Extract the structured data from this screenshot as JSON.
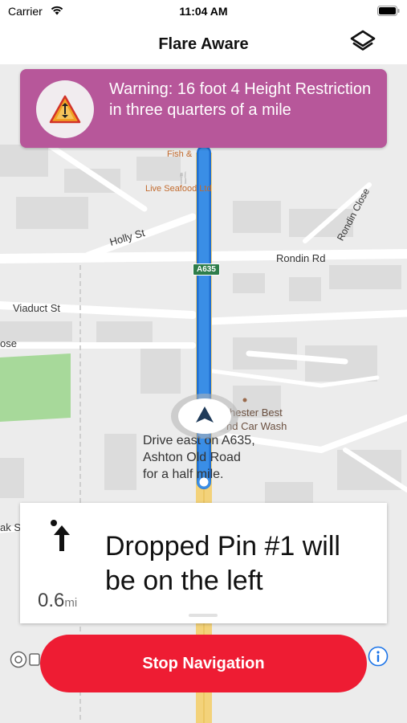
{
  "status_bar": {
    "carrier": "Carrier",
    "time": "11:04 AM"
  },
  "nav": {
    "title": "Flare Aware",
    "layers_icon": "layers-icon"
  },
  "warning": {
    "text": "Warning: 16 foot 4 Height Restriction in three quarters of a mile",
    "icon": "height-restriction-sign-icon",
    "color": "#b7579a"
  },
  "map": {
    "streets": [
      "Holly St",
      "Rondin Rd",
      "Rondin Close",
      "Viaduct St",
      "ose",
      "ak St"
    ],
    "pois": [
      "Fish &",
      "Live Seafood Ltd",
      "hester Best",
      "nd Car Wash"
    ],
    "road_shield": "A635",
    "route_color": "#3a8ee6"
  },
  "route_instruction": {
    "line1": "Drive east on A635,",
    "line2": "Ashton Old Road",
    "line3": "for a half mile."
  },
  "instruction_card": {
    "text": "Dropped Pin #1 will be on the left",
    "distance": "0.6",
    "unit": "mi",
    "turn_icon": "straight-arrow-with-pin-icon"
  },
  "stop_button": {
    "label": "Stop Navigation",
    "color": "#ee1c33"
  },
  "info_icon": "info-icon"
}
